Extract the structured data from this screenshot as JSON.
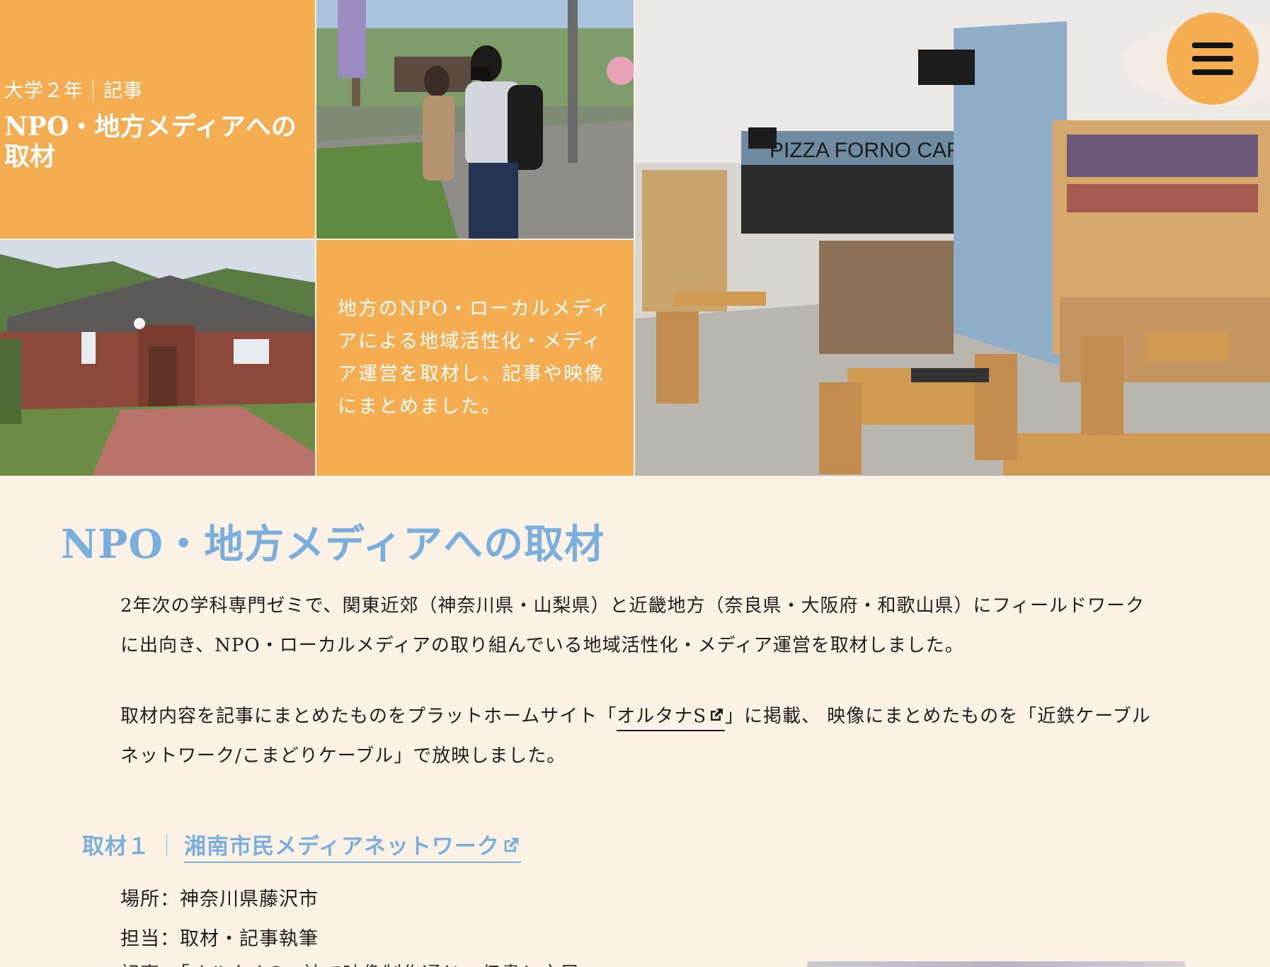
{
  "hero": {
    "eyebrow": "大学２年｜記事",
    "title": "NPO・地方メディアへの取材",
    "description": "地方のNPO・ローカルメディアによる地域活性化・メディア運営を取材し、記事や映像にまとめました。",
    "cafe_sign": "PIZZA FORNO CAFE",
    "accent_color": "#f5ad52"
  },
  "menu": {
    "icon": "hamburger-menu-icon"
  },
  "main": {
    "title": "NPO・地方メディアへの取材",
    "title_color": "#7aaedc",
    "paragraph1": "2年次の学科専門ゼミで、関東近郊（神奈川県・山梨県）と近畿地方（奈良県・大阪府・和歌山県）にフィールドワークに出向き、NPO・ローカルメディアの取り組んでいる地域活性化・メディア運営を取材しました。",
    "paragraph2_before": "取材内容を記事にまとめたものをプラットホームサイト「",
    "paragraph2_link": "オルタナS",
    "paragraph2_after": "」に掲載、 映像にまとめたものを「近鉄ケーブルネットワーク/こまどりケーブル」で放映しました。",
    "external_link_icon": "external-link-icon"
  },
  "section1": {
    "label": "取材１",
    "divider": "｜",
    "org_name": "湘南市民メディアネットワーク",
    "place": "場所：神奈川県藤沢市",
    "role": "担当：取材・記事執筆",
    "cutoff_line": "記事：「オルタナS」誌で映像制作通じ、伝書と市民"
  }
}
